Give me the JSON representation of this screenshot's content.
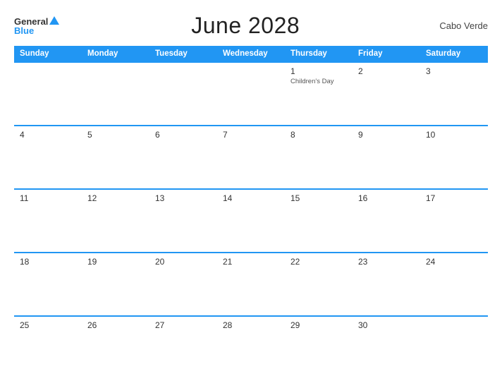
{
  "header": {
    "title": "June 2028",
    "country": "Cabo Verde",
    "logo_line1": "General",
    "logo_line2": "Blue"
  },
  "weekdays": [
    "Sunday",
    "Monday",
    "Tuesday",
    "Wednesday",
    "Thursday",
    "Friday",
    "Saturday"
  ],
  "weeks": [
    [
      {
        "day": "",
        "event": ""
      },
      {
        "day": "",
        "event": ""
      },
      {
        "day": "",
        "event": ""
      },
      {
        "day": "",
        "event": ""
      },
      {
        "day": "1",
        "event": "Children's Day"
      },
      {
        "day": "2",
        "event": ""
      },
      {
        "day": "3",
        "event": ""
      }
    ],
    [
      {
        "day": "4",
        "event": ""
      },
      {
        "day": "5",
        "event": ""
      },
      {
        "day": "6",
        "event": ""
      },
      {
        "day": "7",
        "event": ""
      },
      {
        "day": "8",
        "event": ""
      },
      {
        "day": "9",
        "event": ""
      },
      {
        "day": "10",
        "event": ""
      }
    ],
    [
      {
        "day": "11",
        "event": ""
      },
      {
        "day": "12",
        "event": ""
      },
      {
        "day": "13",
        "event": ""
      },
      {
        "day": "14",
        "event": ""
      },
      {
        "day": "15",
        "event": ""
      },
      {
        "day": "16",
        "event": ""
      },
      {
        "day": "17",
        "event": ""
      }
    ],
    [
      {
        "day": "18",
        "event": ""
      },
      {
        "day": "19",
        "event": ""
      },
      {
        "day": "20",
        "event": ""
      },
      {
        "day": "21",
        "event": ""
      },
      {
        "day": "22",
        "event": ""
      },
      {
        "day": "23",
        "event": ""
      },
      {
        "day": "24",
        "event": ""
      }
    ],
    [
      {
        "day": "25",
        "event": ""
      },
      {
        "day": "26",
        "event": ""
      },
      {
        "day": "27",
        "event": ""
      },
      {
        "day": "28",
        "event": ""
      },
      {
        "day": "29",
        "event": ""
      },
      {
        "day": "30",
        "event": ""
      },
      {
        "day": "",
        "event": ""
      }
    ]
  ],
  "row_styles": [
    "row-gray",
    "row-white",
    "row-gray",
    "row-white",
    "row-gray"
  ]
}
